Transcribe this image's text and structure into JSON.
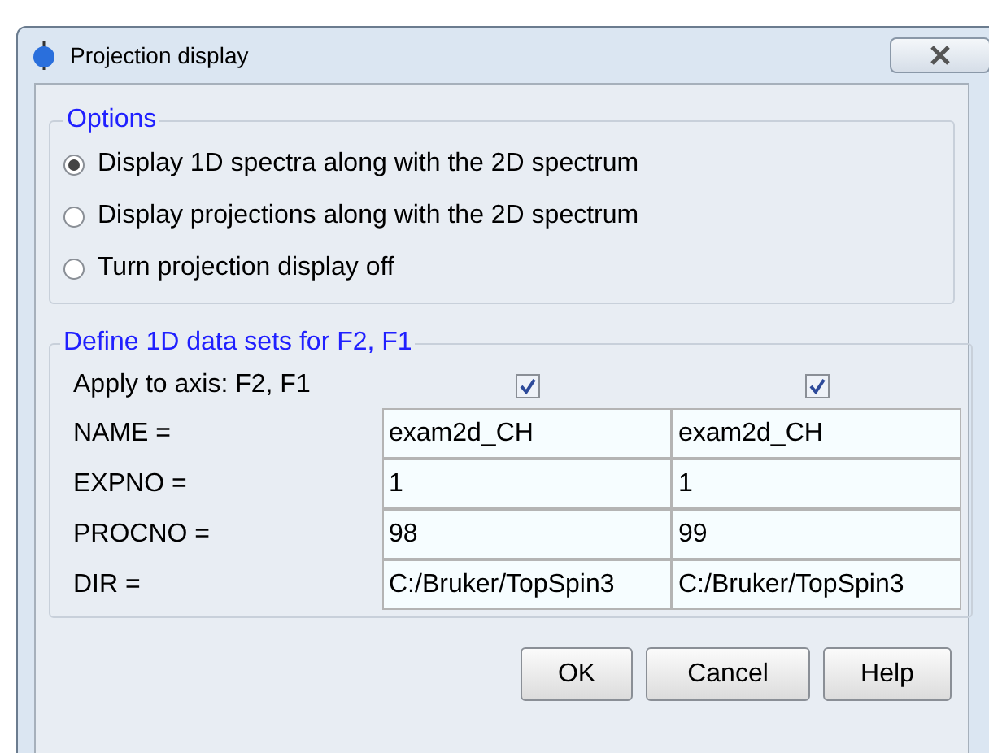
{
  "window": {
    "title": "Projection display"
  },
  "options": {
    "title": "Options",
    "radios": [
      {
        "label": "Display 1D spectra along with the 2D spectrum",
        "selected": true
      },
      {
        "label": "Display projections along with the 2D spectrum",
        "selected": false
      },
      {
        "label": "Turn projection display off",
        "selected": false
      }
    ]
  },
  "datasets": {
    "title": "Define 1D data sets for F2, F1",
    "apply": {
      "label": "Apply to axis: F2, F1",
      "checks": [
        {
          "checked": true
        },
        {
          "checked": true
        }
      ]
    },
    "rows": [
      {
        "label": "NAME =",
        "values": [
          "exam2d_CH",
          "exam2d_CH"
        ]
      },
      {
        "label": "EXPNO =",
        "values": [
          "1",
          "1"
        ]
      },
      {
        "label": "PROCNO =",
        "values": [
          "98",
          "99"
        ]
      },
      {
        "label": "DIR =",
        "values": [
          "C:/Bruker/TopSpin3",
          "C:/Bruker/TopSpin3"
        ]
      }
    ]
  },
  "buttons": [
    "OK",
    "Cancel",
    "Help"
  ]
}
